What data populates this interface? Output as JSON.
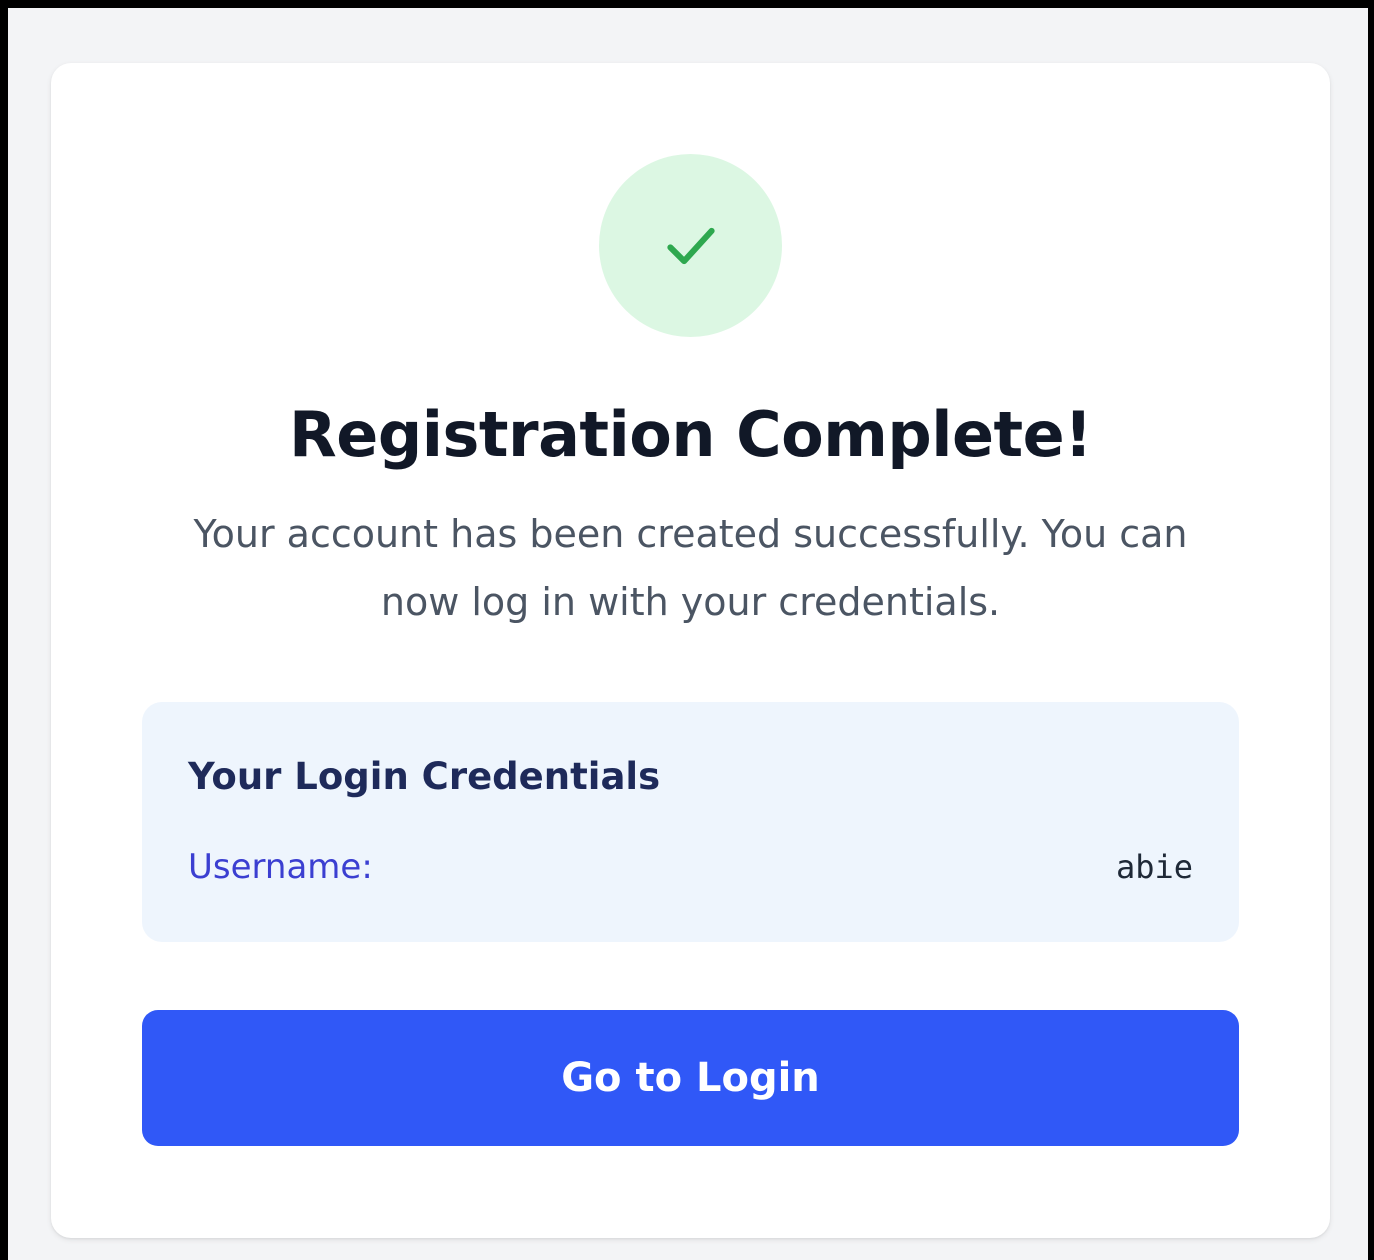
{
  "status": {
    "icon": "check-icon",
    "circle_color": "#dcf7e3",
    "icon_color": "#2ea84f"
  },
  "header": {
    "title": "Registration Complete!",
    "message": "Your account has been created successfully. You can now log in with your credentials."
  },
  "credentials": {
    "title": "Your Login Credentials",
    "username_label": "Username:",
    "username_value": "abie"
  },
  "actions": {
    "login_label": "Go to Login",
    "button_color": "#3058f7"
  }
}
